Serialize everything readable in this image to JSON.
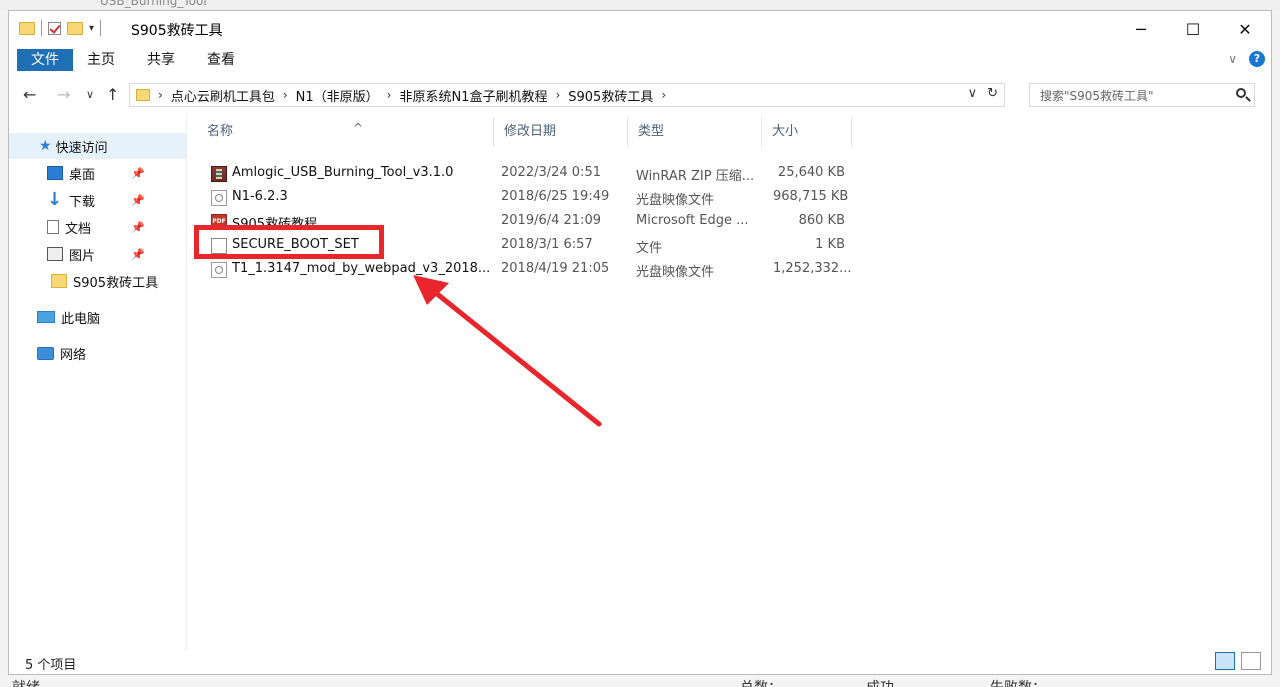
{
  "background": {
    "top_title": "USB_Burning_Tool",
    "bottom_left": "就绪",
    "bottom_total": "总数：",
    "bottom_success": "成功",
    "bottom_fail": "失败数："
  },
  "window": {
    "title": "S905救砖工具",
    "controls": {
      "minimize": "─",
      "maximize": "☐",
      "close": "✕"
    }
  },
  "ribbon": {
    "tabs": [
      "文件",
      "主页",
      "共享",
      "查看"
    ],
    "active_tab": "文件"
  },
  "address": {
    "crumbs": [
      "点心云刷机工具包",
      "N1（非原版）",
      "非原系统N1盒子刷机教程",
      "S905救砖工具"
    ],
    "search_placeholder": "搜索\"S905救砖工具\""
  },
  "nav": {
    "items": [
      {
        "label": "快速访问",
        "icon": "star-icon"
      },
      {
        "label": "桌面",
        "icon": "desktop-icon",
        "pinned": true
      },
      {
        "label": "下载",
        "icon": "download-icon",
        "pinned": true
      },
      {
        "label": "文档",
        "icon": "document-icon",
        "pinned": true
      },
      {
        "label": "图片",
        "icon": "picture-icon",
        "pinned": true
      },
      {
        "label": "S905救砖工具",
        "icon": "folder-icon"
      },
      {
        "label": "此电脑",
        "icon": "computer-icon"
      },
      {
        "label": "网络",
        "icon": "network-icon"
      }
    ]
  },
  "columns": {
    "name": "名称",
    "date": "修改日期",
    "type": "类型",
    "size": "大小"
  },
  "files": [
    {
      "name": "Amlogic_USB_Burning_Tool_v3.1.0",
      "date": "2022/3/24 0:51",
      "type": "WinRAR ZIP 压缩...",
      "size": "25,640 KB",
      "icon": "zip-icon"
    },
    {
      "name": "N1-6.2.3",
      "date": "2018/6/25 19:49",
      "type": "光盘映像文件",
      "size": "968,715 KB",
      "icon": "disc-image-icon"
    },
    {
      "name": "S905救砖教程",
      "date": "2019/6/4 21:09",
      "type": "Microsoft Edge ...",
      "size": "860 KB",
      "icon": "pdf-icon"
    },
    {
      "name": "SECURE_BOOT_SET",
      "date": "2018/3/1 6:57",
      "type": "文件",
      "size": "1 KB",
      "icon": "blank-file-icon"
    },
    {
      "name": "T1_1.3147_mod_by_webpad_v3_2018...",
      "date": "2018/4/19 21:05",
      "type": "光盘映像文件",
      "size": "1,252,332...",
      "icon": "disc-image-icon"
    }
  ],
  "status": {
    "item_count": "5 个项目"
  },
  "annotation_color": "#e8262c"
}
